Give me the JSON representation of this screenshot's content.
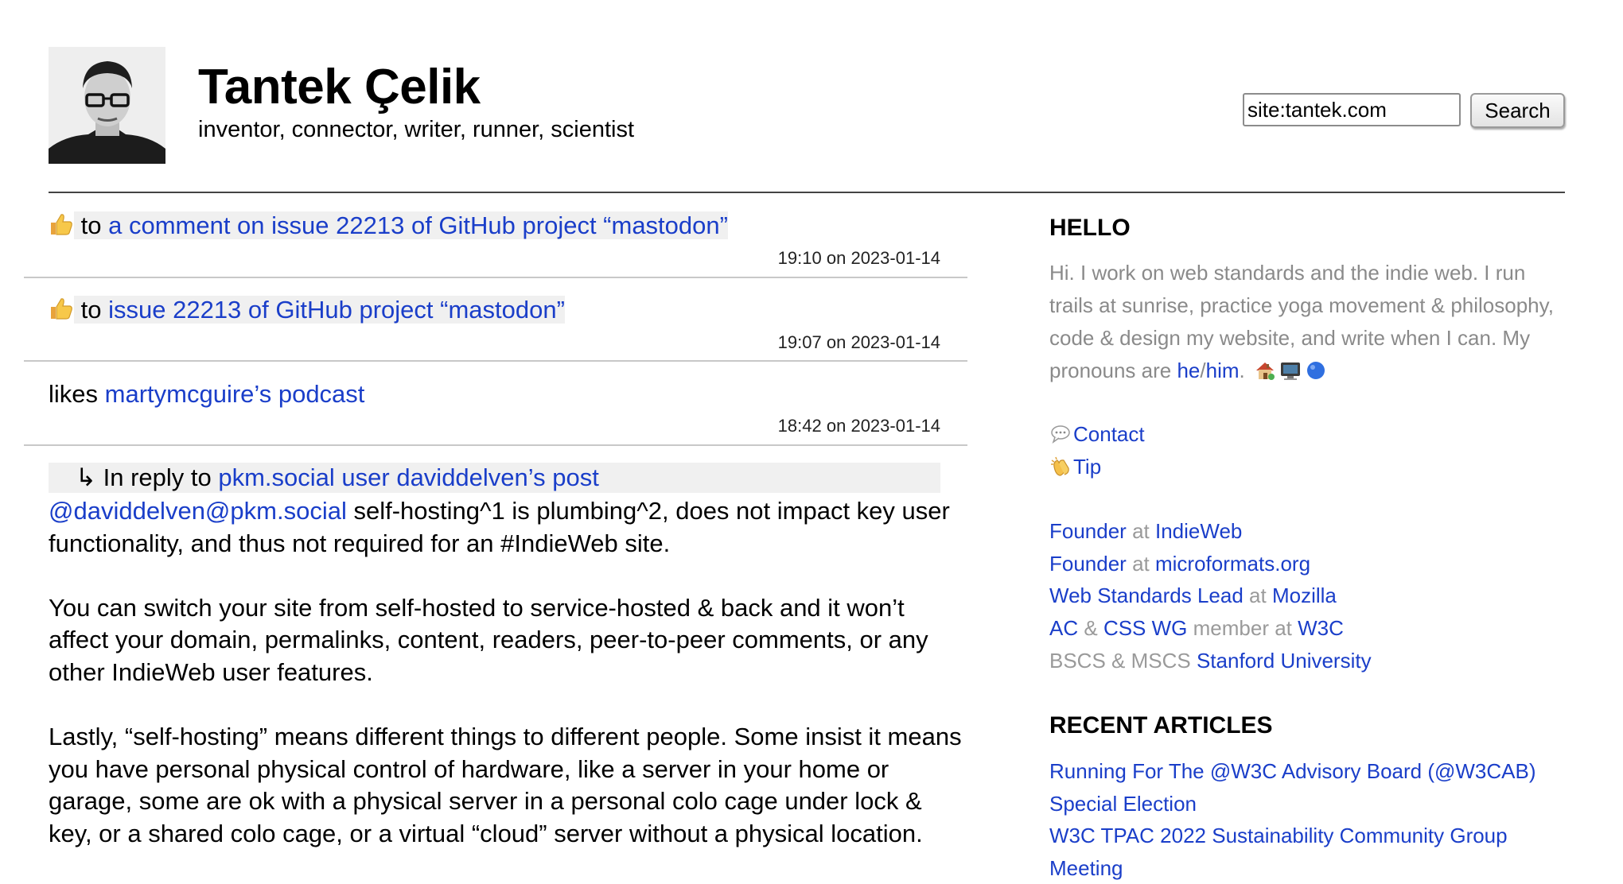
{
  "header": {
    "name": "Tantek Çelik",
    "tagline": "inventor, connector, writer, runner, scientist",
    "search": {
      "value": "site:tantek.com",
      "button_label": "Search"
    }
  },
  "feed": {
    "entries": [
      {
        "icon": "thumbs-up-icon",
        "prefix": "to",
        "link": "a comment on issue 22213 of GitHub project “mastodon”",
        "time": "19:10",
        "on": "on",
        "date": "2023-01-14"
      },
      {
        "icon": "thumbs-up-icon",
        "prefix": "to",
        "link": "issue 22213 of GitHub project “mastodon”",
        "time": "19:07",
        "on": "on",
        "date": "2023-01-14"
      },
      {
        "prefix": "likes",
        "link": "martymcguire’s podcast",
        "time": "18:42",
        "on": "on",
        "date": "2023-01-14"
      }
    ],
    "reply": {
      "arrow": "↳",
      "prefix": "In reply to",
      "link": "pkm.social user daviddelven’s post",
      "mention": "@daviddelven@pkm.social",
      "first_text": "self-hosting^1 is plumbing^2, does not impact key user functionality, and thus not required for an #IndieWeb site.",
      "paragraphs": [
        "You can switch your site from self-hosted to service-hosted & back and it won’t affect your domain, permalinks, content, readers, peer-to-peer comments, or any other IndieWeb user features.",
        "Lastly, “self-hosting” means different things to different people. Some insist it means you have personal physical control of hardware, like a server in your home or garage, some are ok with a physical server in a personal colo cage under lock & key, or a shared colo cage, or a virtual “cloud” server without a physical location."
      ]
    }
  },
  "sidebar": {
    "hello": {
      "heading": "HELLO",
      "text": "Hi. I work on web standards and the indie web. I run trails at sunrise, practice yoga movement & philosophy, code & design my website, and write when I can. My pronouns are",
      "he": "he",
      "slash": "/",
      "him": "him",
      "period": "."
    },
    "contact_label": "Contact",
    "tip_label": "Tip",
    "roles": [
      {
        "role": "Founder",
        "at": "at",
        "org": "IndieWeb"
      },
      {
        "role": "Founder",
        "at": "at",
        "org": "microformats.org"
      },
      {
        "role": "Web Standards Lead",
        "at": "at",
        "org": "Mozilla"
      }
    ],
    "w3c": {
      "ac": "AC",
      "amp": "&",
      "css": "CSS WG",
      "member": "member at",
      "org": "W3C"
    },
    "education": {
      "text": "BSCS & MSCS",
      "org": "Stanford University"
    },
    "recent": {
      "heading": "RECENT ARTICLES",
      "articles": [
        "Running For The @W3C Advisory Board (@W3CAB) Special Election",
        "W3C TPAC 2022 Sustainability Community Group Meeting"
      ]
    }
  },
  "colors": {
    "link": "#1a3ec9",
    "muted": "#8a8a8a",
    "highlight": "#f0f0f0"
  }
}
